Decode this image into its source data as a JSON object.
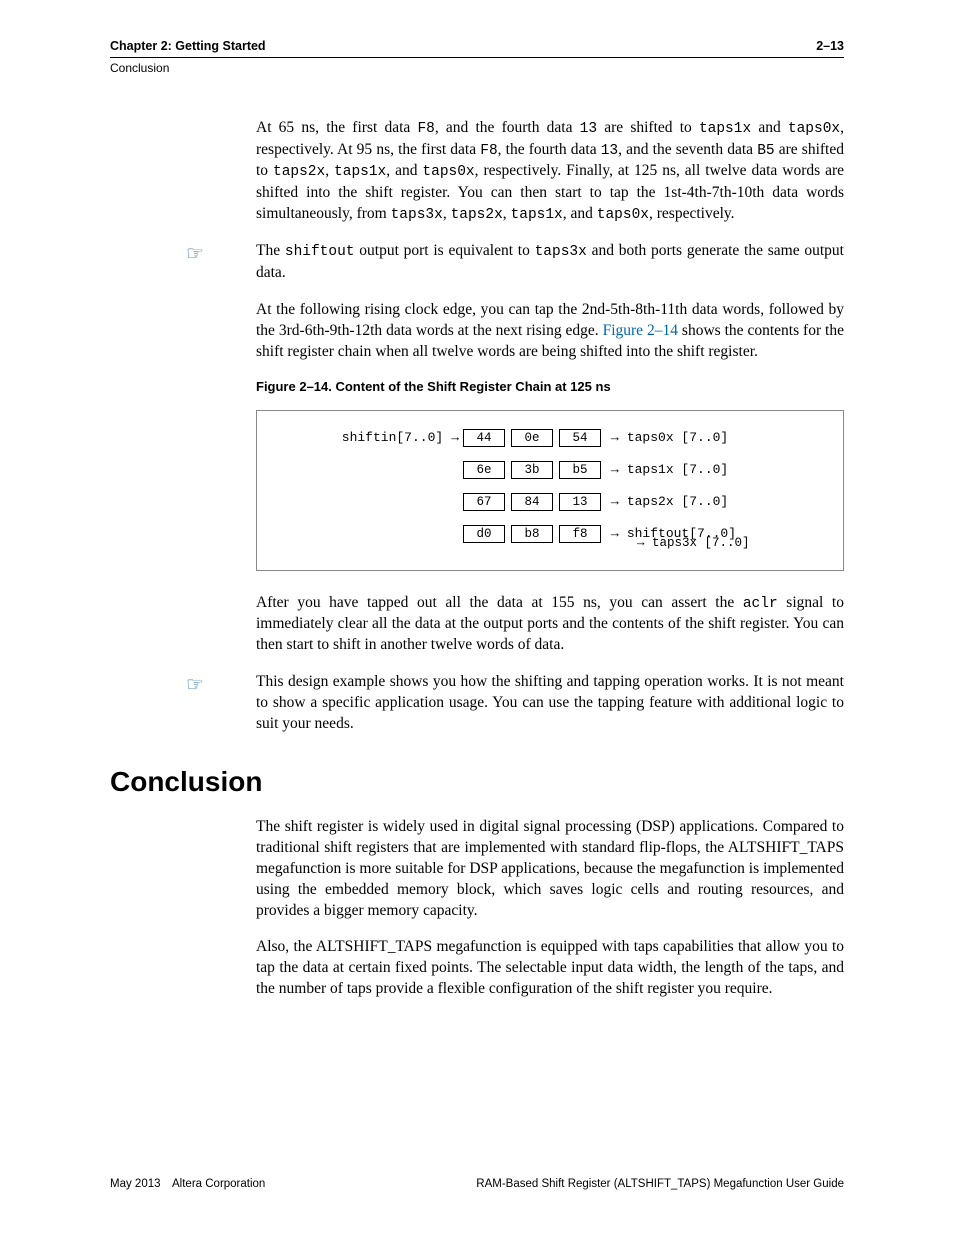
{
  "header": {
    "chapter": "Chapter 2: Getting Started",
    "section": "Conclusion",
    "pagenum": "2–13"
  },
  "p1_pre": "At 65 ns, the first data ",
  "p1_c1": "F8",
  "p1_t2": ", and the fourth data ",
  "p1_c2": "13",
  "p1_t3": " are shifted to ",
  "p1_c3": "taps1x",
  "p1_t4": " and ",
  "p1_c4": "taps0x",
  "p1_t5": ", respectively. At 95 ns, the first data ",
  "p1_c5": "F8",
  "p1_t6": ", the fourth data ",
  "p1_c6": "13",
  "p1_t7": ", and the seventh data ",
  "p1_c7": "B5",
  "p1_t8": " are shifted to ",
  "p1_c8": "taps2x",
  "p1_t9": ", ",
  "p1_c9": "taps1x",
  "p1_t10": ", and ",
  "p1_c10": "taps0x",
  "p1_t11": ", respectively. Finally, at 125 ns, all twelve data words are shifted into the shift register. You can then start to tap the 1st-4th-7th-10th data words simultaneously, from ",
  "p1_c11": "taps3x",
  "p1_t12": ", ",
  "p1_c12": "taps2x",
  "p1_t13": ", ",
  "p1_c13": "taps1x",
  "p1_t14": ", and ",
  "p1_c14": "taps0x",
  "p1_t15": ", respectively.",
  "note1_t1": "The ",
  "note1_c1": "shiftout",
  "note1_t2": " output port is equivalent to ",
  "note1_c2": "taps3x",
  "note1_t3": " and both ports generate the same output data.",
  "p2_t1": "At the following rising clock edge, you can tap the 2nd-5th-8th-11th data words, followed by the 3rd-6th-9th-12th data words at the next rising edge. ",
  "p2_link": "Figure 2–14",
  "p2_t2": " shows the contents for the shift register chain when all twelve words are being shifted into the shift register.",
  "fig_caption": "Figure 2–14. Content of the Shift Register Chain at 125 ns",
  "fig": {
    "shiftin": "shiftin[7..0]",
    "r0": {
      "c": [
        "44",
        "0e",
        "54"
      ],
      "out": "taps0x [7..0]"
    },
    "r1": {
      "c": [
        "6e",
        "3b",
        "b5"
      ],
      "out": "taps1x [7..0]"
    },
    "r2": {
      "c": [
        "67",
        "84",
        "13"
      ],
      "out": "taps2x [7..0]"
    },
    "r3": {
      "c": [
        "d0",
        "b8",
        "f8"
      ],
      "out": "shiftout[7..0]"
    },
    "r3b": "taps3x [7..0]"
  },
  "p3_t1": "After you have tapped out all the data at 155 ns, you can assert the ",
  "p3_c1": "aclr",
  "p3_t2": " signal to immediately clear all the data at the output ports and the contents of the shift register. You can then start to shift in another twelve words of data.",
  "note2": "This design example shows you how the shifting and tapping operation works. It is not meant to show a specific application usage. You can use the tapping feature with additional logic to suit your needs.",
  "h_conclusion": "Conclusion",
  "concl_p1": "The shift register is widely used in digital signal processing (DSP) applications. Compared to traditional shift registers that are implemented with standard flip-flops, the ALTSHIFT_TAPS megafunction is more suitable for DSP applications, because the megafunction is implemented using the embedded memory block, which saves logic cells and routing resources, and provides a bigger memory capacity.",
  "concl_p2": "Also, the ALTSHIFT_TAPS megafunction is equipped with taps capabilities that allow you to tap the data at certain fixed points. The selectable input data width, the length of the taps, and the number of taps provide a flexible configuration of the shift register you require.",
  "footer": {
    "left": "May 2013 Altera Corporation",
    "right": "RAM-Based Shift Register (ALTSHIFT_TAPS) Megafunction User Guide"
  }
}
